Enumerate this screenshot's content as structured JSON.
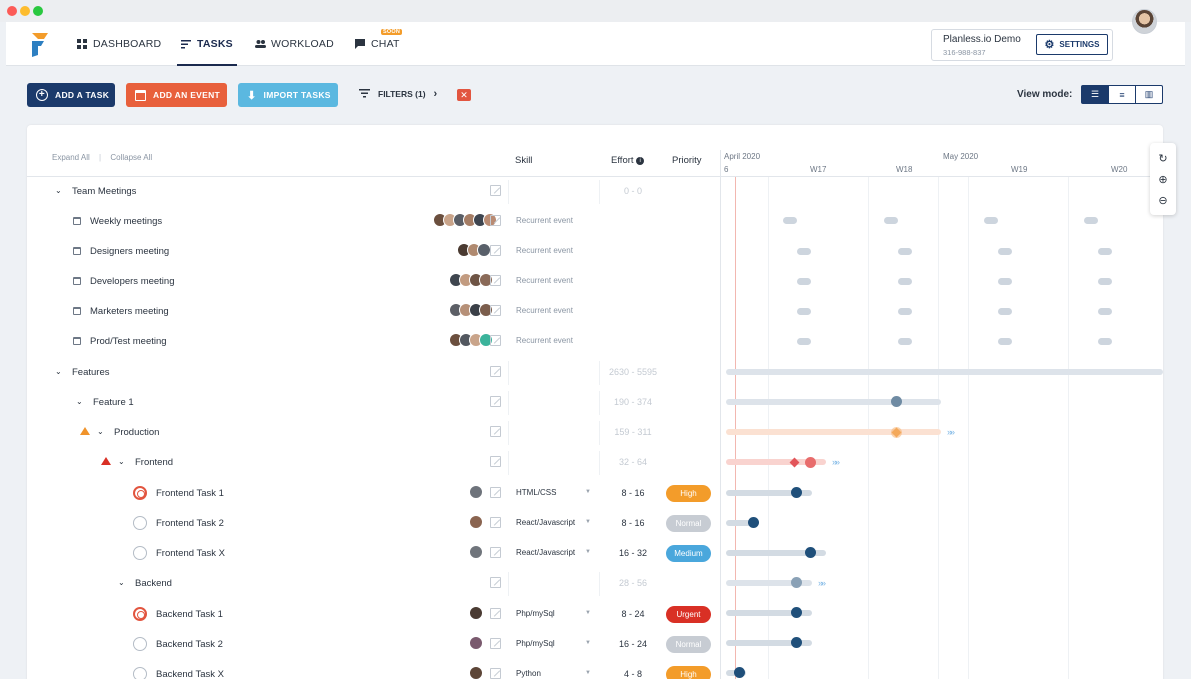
{
  "colors": {
    "primary": "#1b3a6b",
    "event": "#e8603c",
    "import": "#5bb8e0",
    "high": "#f39c2a",
    "normal": "#c7ccd3",
    "medium": "#4aa7dc",
    "urgent": "#d93025",
    "progress": "#1f4f7a",
    "today": "#f2b7b0"
  },
  "nav": {
    "dashboard": "DASHBOARD",
    "tasks": "TASKS",
    "workload": "WORKLOAD",
    "chat": "CHAT",
    "chat_badge": "SOON"
  },
  "account": {
    "name": "Planless.io Demo",
    "phone": "316-988-837",
    "settings": "SETTINGS"
  },
  "toolbar": {
    "add_task": "ADD A TASK",
    "add_event": "ADD AN EVENT",
    "import": "IMPORT TASKS",
    "filters": "FILTERS (1)",
    "view_mode": "View mode:"
  },
  "table": {
    "expand_all": "Expand All",
    "separator": "|",
    "collapse_all": "Collapse All",
    "headers": {
      "skill": "Skill",
      "effort": "Effort",
      "priority": "Priority"
    }
  },
  "timeline": {
    "months": [
      "April 2020",
      "May 2020"
    ],
    "day": "6",
    "weeks": [
      "W17",
      "W18",
      "W19",
      "W20"
    ]
  },
  "rows": [
    {
      "label": "Team Meetings",
      "effort": "0 - 0"
    },
    {
      "label": "Weekly meetings",
      "skill": "Recurrent event"
    },
    {
      "label": "Designers meeting",
      "skill": "Recurrent event"
    },
    {
      "label": "Developers meeting",
      "skill": "Recurrent event"
    },
    {
      "label": "Marketers meeting",
      "skill": "Recurrent event"
    },
    {
      "label": "Prod/Test meeting",
      "skill": "Recurrent event"
    },
    {
      "label": "Features",
      "effort": "2630 - 5595"
    },
    {
      "label": "Feature 1",
      "effort": "190 - 374"
    },
    {
      "label": "Production",
      "effort": "159 - 311"
    },
    {
      "label": "Frontend",
      "effort": "32 - 64"
    },
    {
      "label": "Frontend Task 1",
      "skill": "HTML/CSS",
      "effort": "8 - 16",
      "priority": "High"
    },
    {
      "label": "Frontend Task 2",
      "skill": "React/Javascript",
      "effort": "8 - 16",
      "priority": "Normal"
    },
    {
      "label": "Frontend Task X",
      "skill": "React/Javascript",
      "effort": "16 - 32",
      "priority": "Medium"
    },
    {
      "label": "Backend",
      "effort": "28 - 56"
    },
    {
      "label": "Backend Task 1",
      "skill": "Php/mySql",
      "effort": "8 - 24",
      "priority": "Urgent"
    },
    {
      "label": "Backend Task 2",
      "skill": "Php/mySql",
      "effort": "16 - 24",
      "priority": "Normal"
    },
    {
      "label": "Backend Task X",
      "skill": "Python",
      "effort": "4 - 8",
      "priority": "High"
    }
  ]
}
